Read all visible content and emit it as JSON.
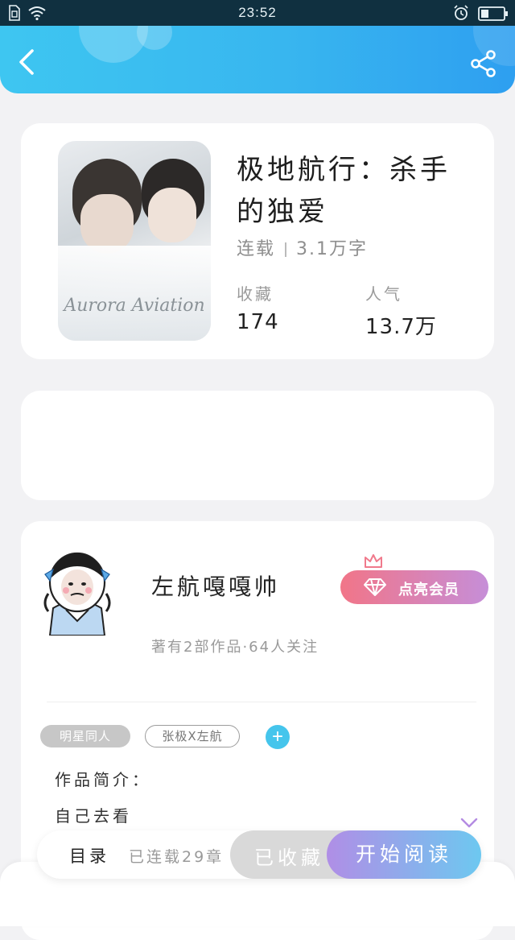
{
  "status_bar": {
    "time": "23:52",
    "icons": [
      "sim-icon",
      "wifi-icon",
      "alarm-icon",
      "battery-icon"
    ]
  },
  "header": {
    "colors": {
      "start": "#3ec6f1",
      "end": "#2e9ff0"
    },
    "back_icon": "chevron-left-icon",
    "share_icon": "share-icon"
  },
  "book": {
    "cover_text": "Aurora Aviation",
    "title": "极地航行：杀手的独爱",
    "status": "连载",
    "word_count": "3.1万字",
    "stats": [
      {
        "label": "收藏",
        "value": "174"
      },
      {
        "label": "人气",
        "value": "13.7万"
      }
    ]
  },
  "author": {
    "name": "左航嘎嘎帅",
    "vip_label": "点亮会员",
    "stats_text": "著有2部作品·64人关注",
    "tags": [
      "明星同人",
      "张极X左航"
    ],
    "intro_label": "作品简介：",
    "intro_text": "自己去看"
  },
  "bottom_bar": {
    "toc_label": "目录",
    "chapter_status": "已连载29章",
    "collect_label": "已收藏",
    "read_label": "开始阅读"
  }
}
